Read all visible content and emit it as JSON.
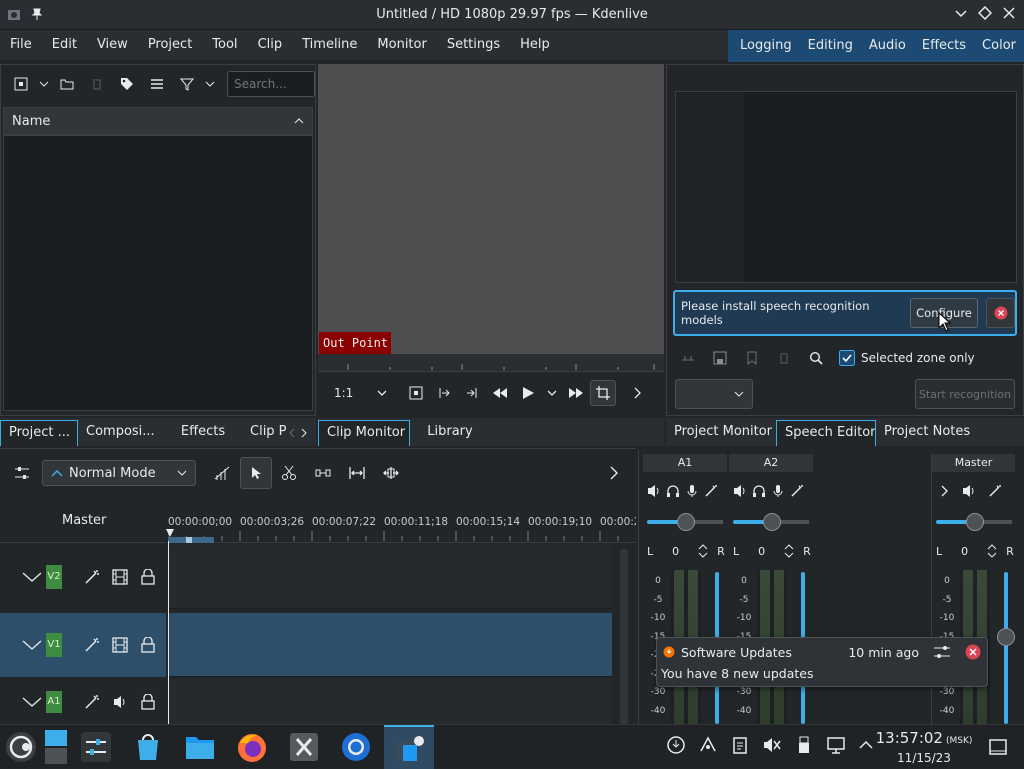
{
  "window": {
    "title": "Untitled / HD 1080p 29.97 fps — Kdenlive"
  },
  "menu": [
    "File",
    "Edit",
    "View",
    "Project",
    "Tool",
    "Clip",
    "Timeline",
    "Monitor",
    "Settings",
    "Help"
  ],
  "layouts": [
    "Logging",
    "Editing",
    "Audio",
    "Effects",
    "Color"
  ],
  "bin": {
    "search_placeholder": "Search...",
    "column_name": "Name"
  },
  "left_tabs": [
    "Project ...",
    "Composi...",
    "Effects",
    "Clip P"
  ],
  "monitor": {
    "out_point": "Out Point",
    "zoom": "1:1",
    "tabs": [
      "Clip Monitor",
      "Library"
    ]
  },
  "speech": {
    "message": "Please install speech recognition models",
    "configure": "Configure",
    "selected_zone": "Selected zone only",
    "start": "Start recognition",
    "tabs": [
      "Project Monitor",
      "Speech Editor",
      "Project Notes"
    ]
  },
  "timeline": {
    "mode": "Normal Mode",
    "master": "Master",
    "ruler": [
      "00:00:00;00",
      "00:00:03;26",
      "00:00:07;22",
      "00:00:11;18",
      "00:00:15;14",
      "00:00:19;10",
      "00:00:2"
    ],
    "tracks": [
      {
        "tag": "V2",
        "type": "video"
      },
      {
        "tag": "V1",
        "type": "video"
      },
      {
        "tag": "A1",
        "type": "audio"
      }
    ]
  },
  "mixer": {
    "channels": [
      "A1",
      "A2",
      "Master"
    ],
    "L": "L",
    "R": "R",
    "gain": "0",
    "scale": [
      "0",
      "-5",
      "-10",
      "-15",
      "-20",
      "-25",
      "-30",
      "-40"
    ]
  },
  "notification": {
    "app": "Software Updates",
    "time": "10 min ago",
    "body": "You have 8 new updates"
  },
  "taskbar": {
    "time": "13:57:02",
    "tz": "(MSK)",
    "date": "11/15/23"
  },
  "colors": {
    "accent": "#3daee9",
    "layout_bar": "#1d4a73",
    "out_point_bg": "#8b0000",
    "track_green": "#3d8c40",
    "close_red": "#da4453"
  }
}
